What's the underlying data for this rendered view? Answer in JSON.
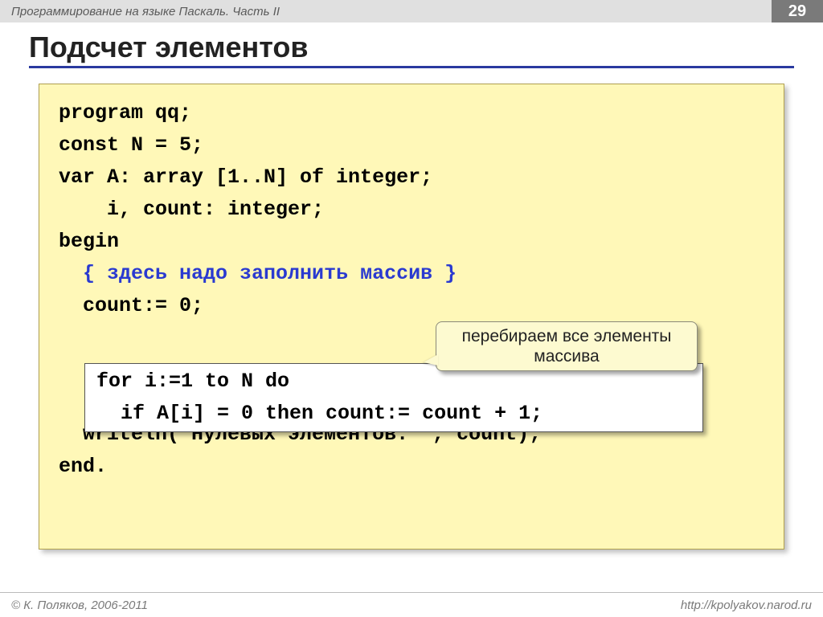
{
  "header": {
    "course_title": "Программирование на языке Паскаль. Часть II",
    "page_number": "29"
  },
  "title": "Подсчет элементов",
  "code": {
    "l1": "program qq;",
    "l2": "const N = 5;",
    "l3": "var A: array [1..N] of integer;",
    "l4": "    i, count: integer;",
    "l5": "begin",
    "l6_indent": "  ",
    "l6_comment": "{ здесь надо заполнить массив }",
    "l7": "  count:= 0;",
    "loop_l1": "for i:=1 to N do",
    "loop_l2": "  if A[i] = 0 then count:= count + 1;",
    "l10": "  writeln('Нулевых элементов: ', count);",
    "l11": "end."
  },
  "callout": "перебираем все элементы массива",
  "footer": {
    "copyright": "© К. Поляков, 2006-2011",
    "url": "http://kpolyakov.narod.ru"
  }
}
